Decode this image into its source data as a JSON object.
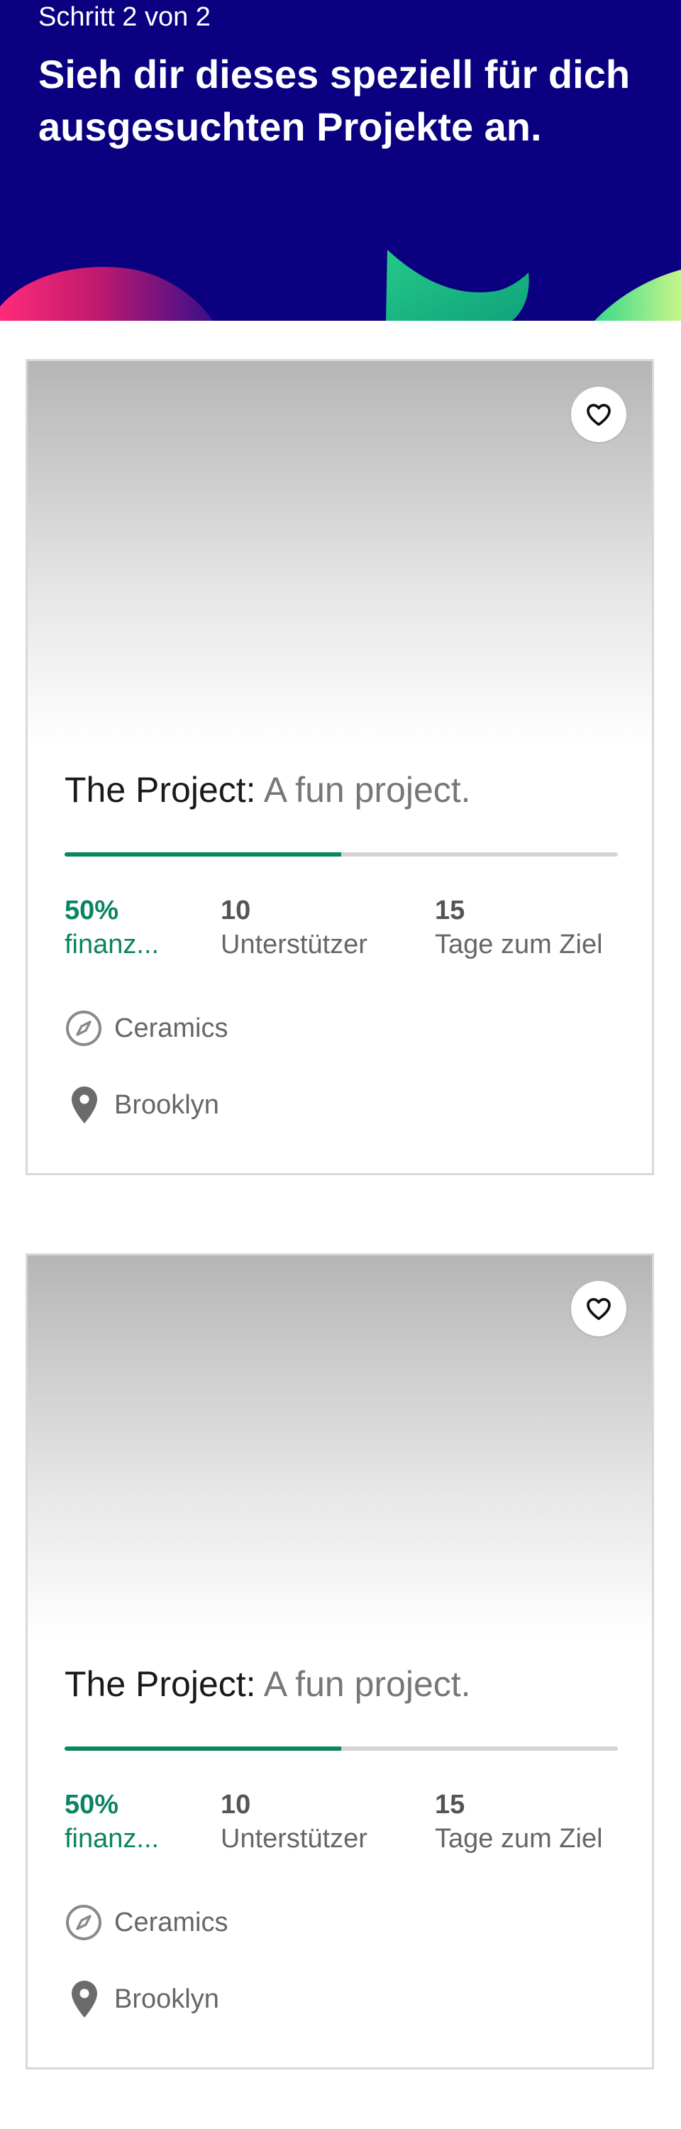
{
  "header": {
    "step": "Schritt 2 von 2",
    "title": "Sieh dir dieses speziell für dich ausgesuchten Projekte an."
  },
  "colors": {
    "header_background": "#0b0180",
    "accent_green": "#0b8461"
  },
  "projects": [
    {
      "name": "The Project:",
      "blurb": "A fun project.",
      "funded_fraction": 0.5,
      "funded_percent": "50%",
      "funded_label": "finanz...",
      "backers_count": "10",
      "backers_label": "Unterstützer",
      "days_count": "15",
      "days_label": "Tage zum Ziel",
      "category": "Ceramics",
      "location": "Brooklyn",
      "icons": {
        "favorite": "heart-icon",
        "category": "compass-icon",
        "location": "map-pin-icon"
      }
    },
    {
      "name": "The Project:",
      "blurb": "A fun project.",
      "funded_fraction": 0.5,
      "funded_percent": "50%",
      "funded_label": "finanz...",
      "backers_count": "10",
      "backers_label": "Unterstützer",
      "days_count": "15",
      "days_label": "Tage zum Ziel",
      "category": "Ceramics",
      "location": "Brooklyn",
      "icons": {
        "favorite": "heart-icon",
        "category": "compass-icon",
        "location": "map-pin-icon"
      }
    }
  ]
}
